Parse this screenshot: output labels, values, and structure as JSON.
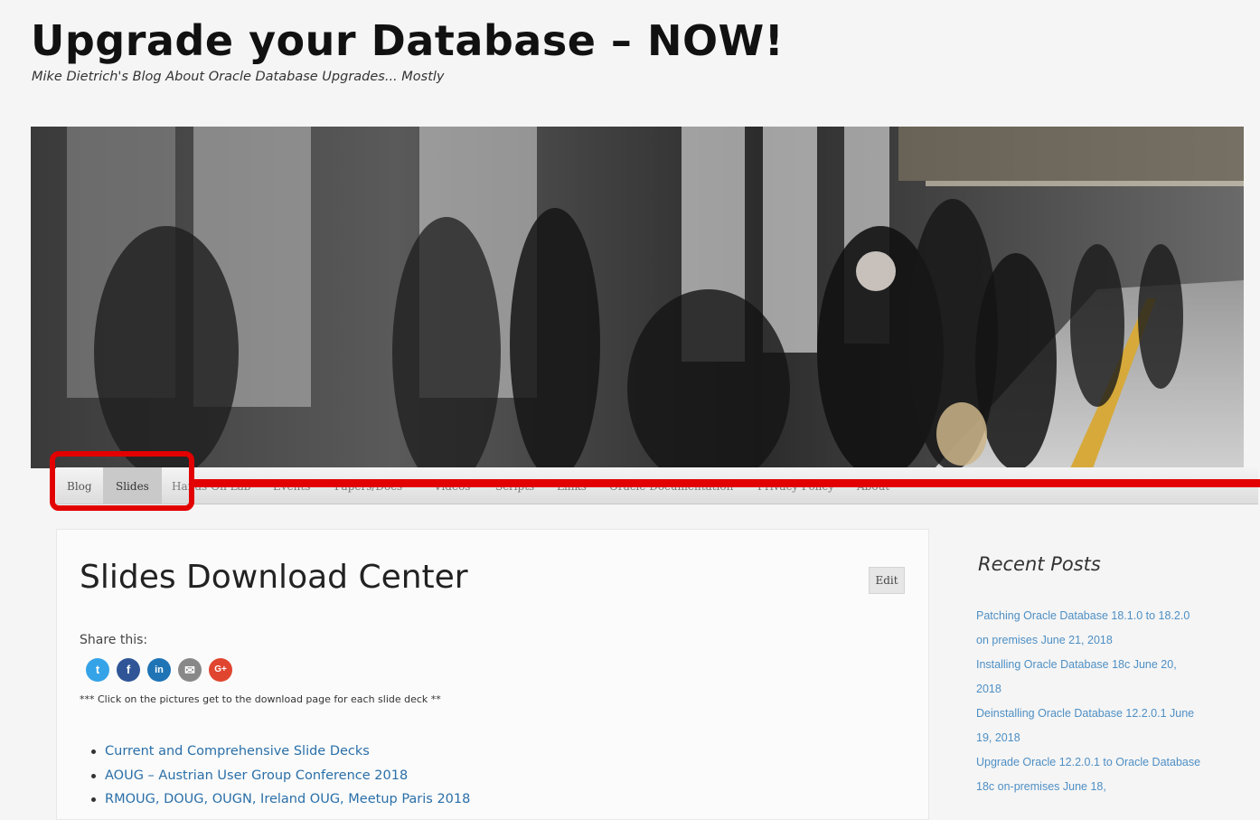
{
  "site": {
    "title": "Upgrade your Database – NOW!",
    "tagline": "Mike Dietrich's Blog About Oracle Database Upgrades... Mostly"
  },
  "nav": {
    "items": [
      {
        "label": "Blog",
        "active": false
      },
      {
        "label": "Slides",
        "active": true
      },
      {
        "label": "Hands-On Lab",
        "active": false
      },
      {
        "label": "Events",
        "active": false
      },
      {
        "label": "Papers/Docs",
        "active": false
      },
      {
        "label": "Videos",
        "active": false
      },
      {
        "label": "Scripts",
        "active": false
      },
      {
        "label": "Links",
        "active": false
      },
      {
        "label": "Oracle Documentation",
        "active": false
      },
      {
        "label": "Privacy Policy",
        "active": false
      },
      {
        "label": "About",
        "active": false
      }
    ],
    "highlight_color": "#e20000"
  },
  "page": {
    "title": "Slides Download Center",
    "edit_label": "Edit",
    "share_label": "Share this:",
    "share_icons": [
      {
        "icon": "twitter-icon",
        "glyph": "t",
        "color": "#35a3e8"
      },
      {
        "icon": "facebook-icon",
        "glyph": "f",
        "color": "#2f5597"
      },
      {
        "icon": "linkedin-icon",
        "glyph": "in",
        "color": "#1f74b5"
      },
      {
        "icon": "email-icon",
        "glyph": "✉",
        "color": "#888888"
      },
      {
        "icon": "google-plus-icon",
        "glyph": "G+",
        "color": "#e0452f"
      }
    ],
    "note": "*** Click on the pictures get to the download page for each slide deck **",
    "slide_links": [
      "Current and Comprehensive Slide Decks",
      "AOUG – Austrian User Group Conference 2018",
      "RMOUG, DOUG, OUGN, Ireland OUG, Meetup Paris 2018"
    ]
  },
  "sidebar": {
    "recent_title": "Recent Posts",
    "recent_posts": [
      {
        "title": "Patching Oracle Database 18.1.0 to 18.2.0 on premises",
        "date": "June 21, 2018"
      },
      {
        "title": "Installing Oracle Database 18c",
        "date": "June 20, 2018"
      },
      {
        "title": "Deinstalling Oracle Database 12.2.0.1",
        "date": "June 19, 2018"
      },
      {
        "title": "Upgrade Oracle 12.2.0.1 to Oracle Database 18c on-premises",
        "date": "June 18,"
      }
    ]
  }
}
